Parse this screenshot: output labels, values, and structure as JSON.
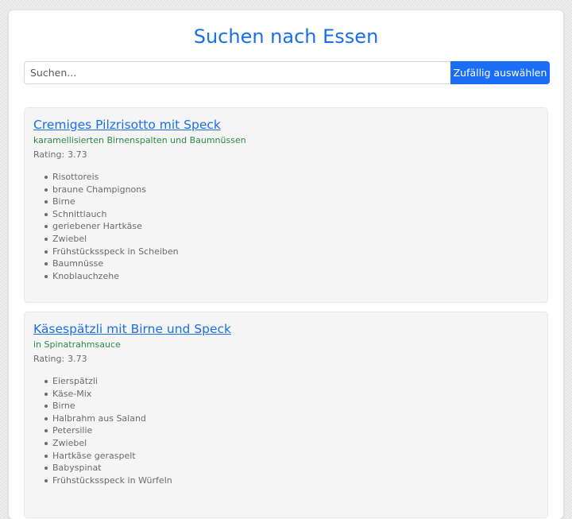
{
  "header": {
    "title": "Suchen nach Essen"
  },
  "search": {
    "placeholder": "Suchen...",
    "value": "",
    "random_button_label": "Zufällig auswählen"
  },
  "colors": {
    "title": "#1a6fe8",
    "button": "#1a6ef5",
    "subtitle": "#2a8a47",
    "muted_text": "#6b6b6b"
  },
  "recipes": [
    {
      "title": "Cremiges Pilzrisotto mit Speck",
      "subtitle": "karamellisierten Birnenspalten und Baumnüssen",
      "rating_label": "Rating:",
      "rating": "3.73",
      "ingredients": [
        "Risottoreis",
        "braune Champignons",
        "Birne",
        "Schnittlauch",
        "geriebener Hartkäse",
        "Zwiebel",
        "Frühstücksspeck in Scheiben",
        "Baumnüsse",
        "Knoblauchzehe"
      ]
    },
    {
      "title": "Käsespätzli mit Birne und Speck",
      "subtitle": "in Spinatrahmsauce",
      "rating_label": "Rating:",
      "rating": "3.73",
      "ingredients": [
        "Eierspätzli",
        "Käse-Mix",
        "Birne",
        "Halbrahm aus Saland",
        "Petersilie",
        "Zwiebel",
        "Hartkäse geraspelt",
        "Babyspinat",
        "Frühstücksspeck in Würfeln"
      ]
    }
  ]
}
